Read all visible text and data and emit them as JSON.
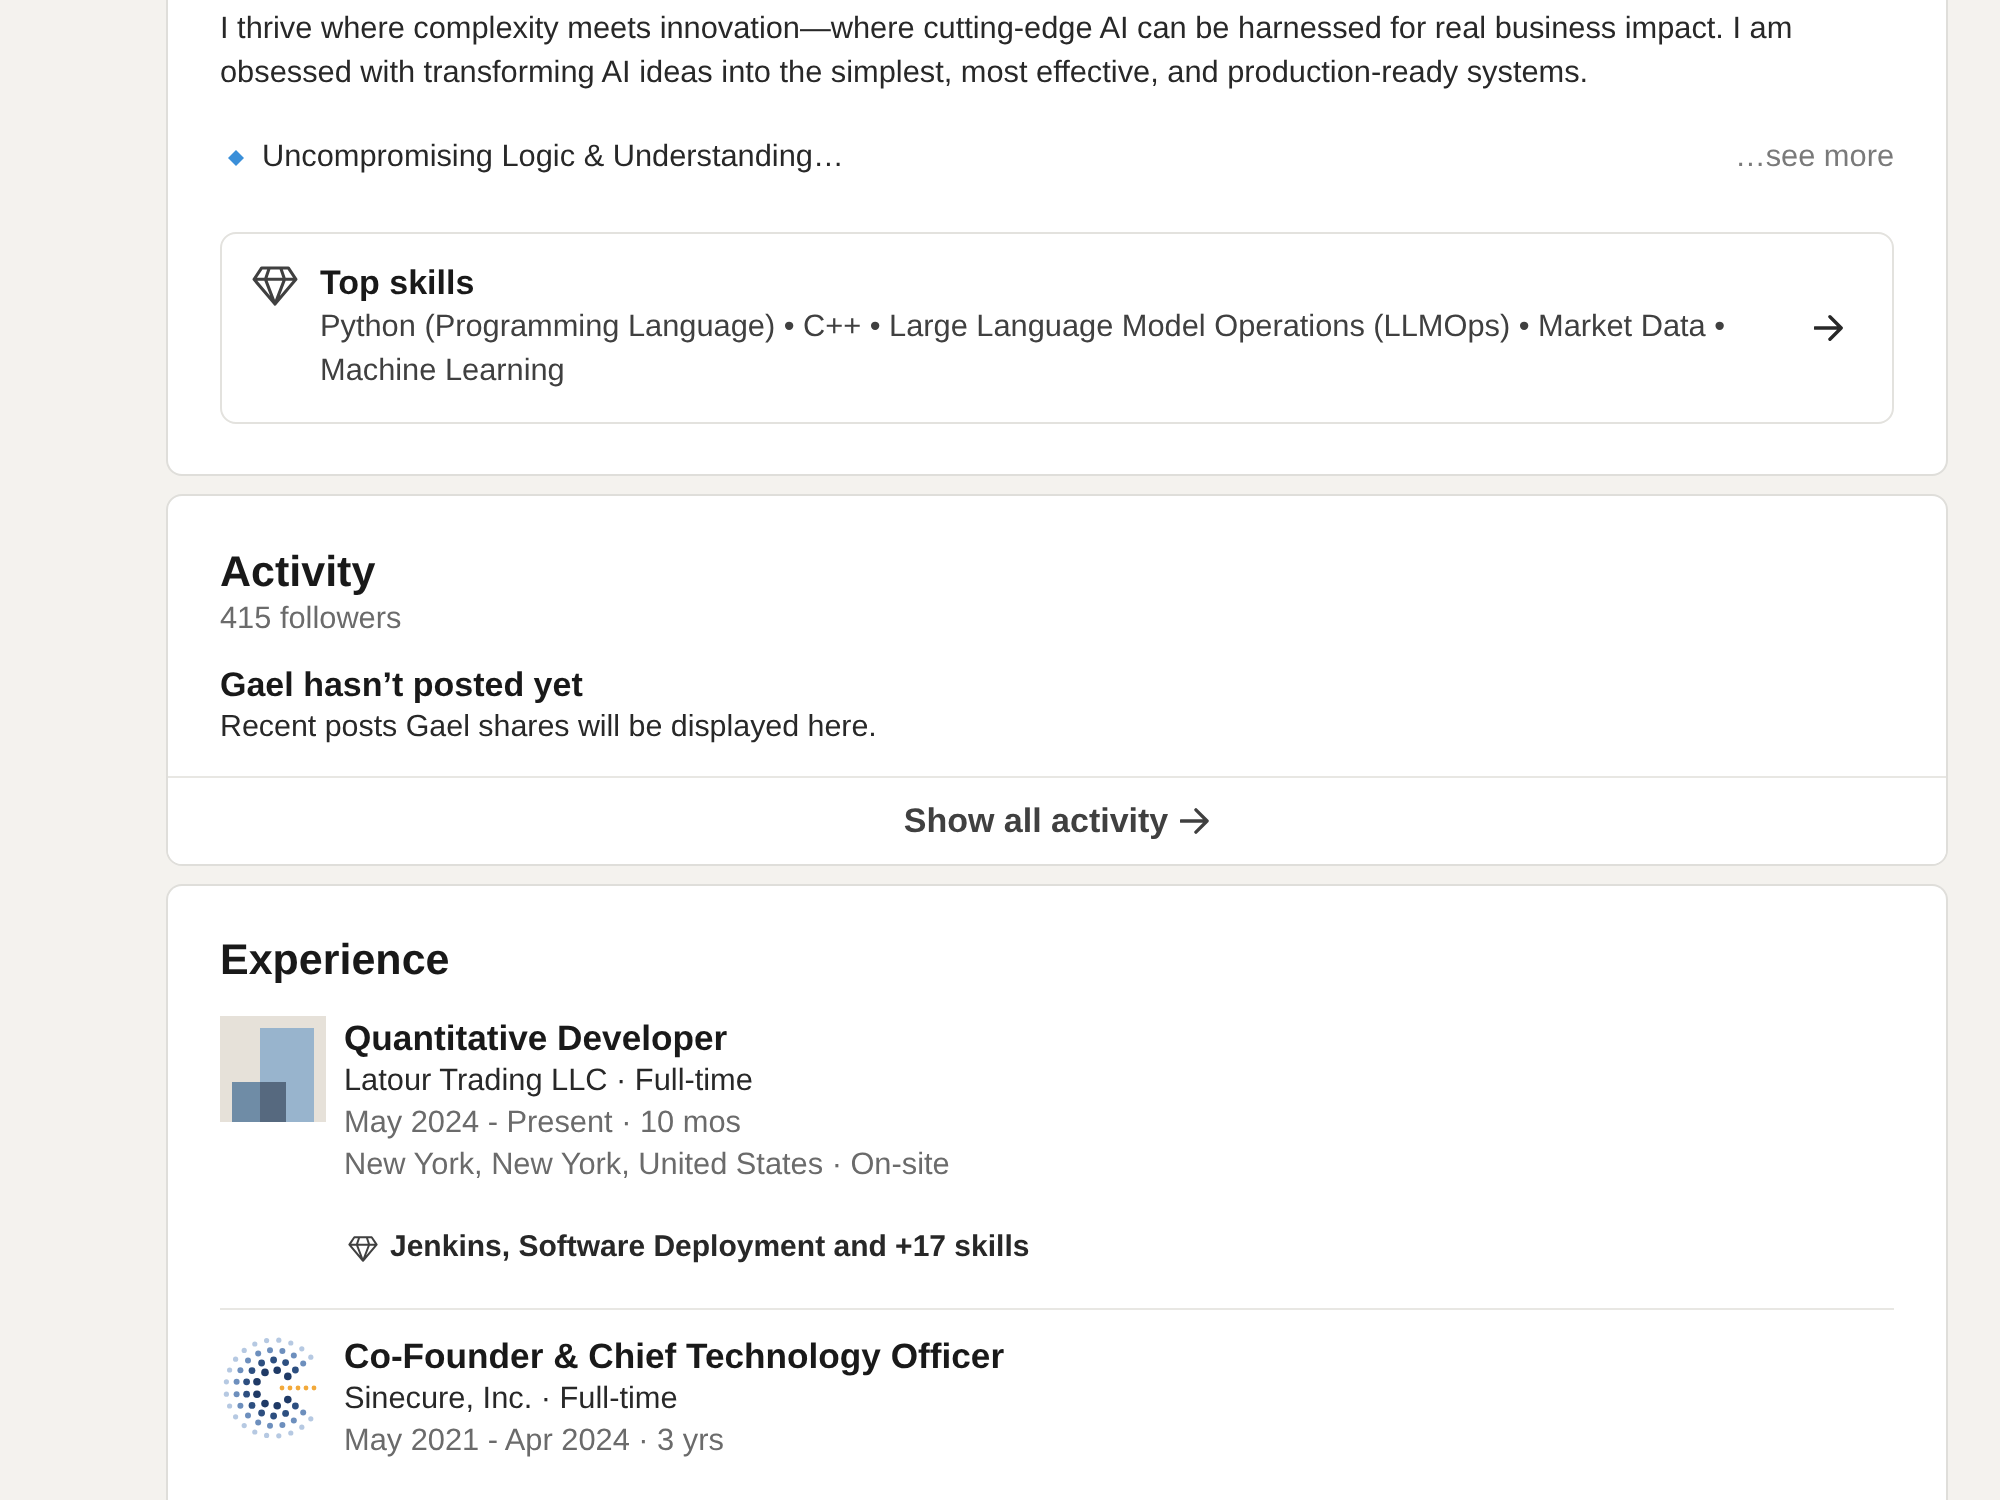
{
  "about": {
    "text": "I thrive where complexity meets innovation—where cutting-edge AI can be harnessed for real business impact. I am obsessed with transforming AI ideas into the simplest, most effective, and production-ready systems.",
    "highlight": "Uncompromising Logic & Understanding…",
    "see_more": "…see more",
    "top_skills": {
      "title": "Top skills",
      "skills": "Python (Programming Language) • C++ • Large Language Model Operations (LLMOps) • Market Data • Machine Learning"
    }
  },
  "activity": {
    "title": "Activity",
    "followers": "415 followers",
    "empty_title": "Gael hasn’t posted yet",
    "empty_text": "Recent posts Gael shares will be displayed here.",
    "show_all": "Show all activity"
  },
  "experience": {
    "title": "Experience",
    "items": [
      {
        "title": "Quantitative Developer",
        "company": "Latour Trading LLC · Full-time",
        "dates": "May 2024 - Present · 10 mos",
        "location": "New York, New York, United States · On-site",
        "skills": "Jenkins, Software Deployment and +17 skills"
      },
      {
        "title": "Co-Founder & Chief Technology Officer",
        "company": "Sinecure, Inc. · Full-time",
        "dates": "May 2021 - Apr 2024 · 3 yrs"
      }
    ]
  }
}
